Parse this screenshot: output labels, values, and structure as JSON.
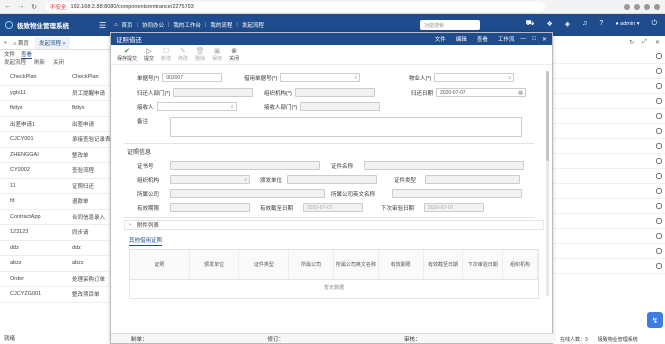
{
  "browser": {
    "url_warning": "不安全",
    "url": "192.168.2.88:8080/components/entrance/2275793"
  },
  "header": {
    "app_title": "极致物业管理系统",
    "nav": [
      "首页",
      "协同办公",
      "我的工作台",
      "我的流程",
      "发起流程"
    ],
    "search_placeholder": "功能搜索",
    "user": "admin"
  },
  "tabs": {
    "home": "首页",
    "active": "发起流程"
  },
  "left_toolbar": {
    "mode_tabs": [
      "文件",
      "查看"
    ],
    "actions": [
      "发起流程",
      "刷新",
      "关闭"
    ]
  },
  "left_list": [
    [
      "CheckPlan",
      "CheckPlan"
    ],
    [
      "ygtx11",
      "员工提醒申请"
    ],
    [
      "fktlys",
      "fktlys"
    ],
    [
      "出差申请1",
      "出差申请"
    ],
    [
      "CJCY001",
      "承接查验记录表"
    ],
    [
      "ZHENGGAI",
      "整改单"
    ],
    [
      "CY0002",
      "查验流程"
    ],
    [
      "11",
      "证照归还"
    ],
    [
      "fd",
      "退款单"
    ],
    [
      "ContractApp",
      "合同信息录入"
    ],
    [
      "123123",
      "同步请"
    ],
    [
      "ddz",
      "ddz"
    ],
    [
      "abzz",
      "abzz"
    ],
    [
      "Order",
      "处理采购订单"
    ],
    [
      "CJCYZG001",
      "整改项目单"
    ]
  ],
  "left_footer": "就绪",
  "right_footer": {
    "online": "在线人数：3",
    "company": "极致物业管理系统"
  },
  "modal": {
    "title": "证照借还",
    "menu": [
      "文件",
      "编辑",
      "查看",
      "工作流"
    ],
    "win": [
      "—",
      "□",
      "✕"
    ],
    "toolbar": [
      {
        "label": "保存提交",
        "icon": "✔"
      },
      {
        "label": "提交",
        "icon": "▷"
      },
      {
        "label": "新增",
        "icon": "☐"
      },
      {
        "label": "修改",
        "icon": "✎"
      },
      {
        "label": "删除",
        "icon": "🗑"
      },
      {
        "label": "保存",
        "icon": "▣"
      },
      {
        "label": "关闭",
        "icon": "⊗"
      }
    ],
    "form": {
      "bill_no_label": "单据号(*)",
      "bill_no_value": "002007",
      "borrow_bill_label": "借用单据号(*)",
      "property_label": "物业人(*)",
      "returner_dept_label": "归还人部门(*)",
      "org_label": "组织机构(*)",
      "return_date_label": "归还日期",
      "return_date_value": "2020-07-07",
      "receiver_label": "接收人",
      "receiver_dept_label": "接收人部门(*)",
      "remark_label": "备注"
    },
    "cert_section": {
      "title": "证照信息",
      "cert_no": "证书号",
      "cert_name": "证件名称",
      "org": "组织机构",
      "issuer": "颁发单位",
      "cert_type": "证件类型",
      "owner_company": "所属公司",
      "owner_company_en": "所属公司英文名称",
      "valid_period": "有效期限",
      "valid_until": "有效截至日期",
      "valid_until_value": "2020-07-07",
      "next_review": "下次审验日期",
      "next_review_value": "2020-07-07"
    },
    "attachments": "附件列表",
    "subtab": "其他借用证照",
    "grid_headers": [
      "证照",
      "颁发单位",
      "证件类型",
      "所属公司",
      "所属公司英文名称",
      "有效期限",
      "有效截至日期",
      "下次审验日期",
      "组织机构"
    ],
    "grid_empty": "暂无数据",
    "footer": {
      "maker": "制单：",
      "modifier": "修订：",
      "reviewer": "审核："
    }
  }
}
